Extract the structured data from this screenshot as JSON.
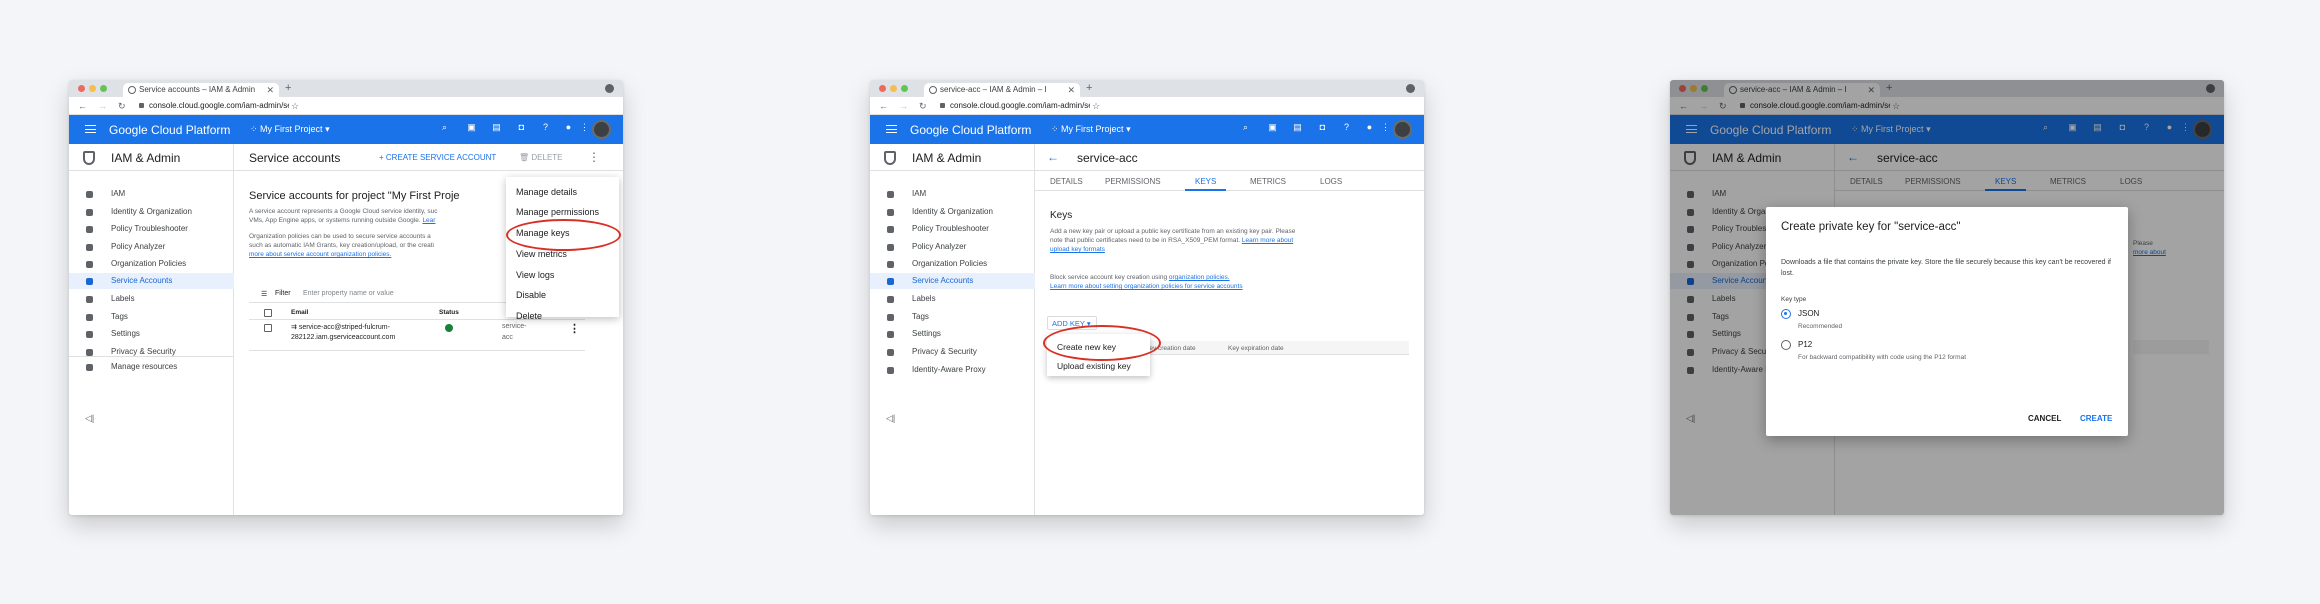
{
  "windows": [
    {
      "tab_title": "Service accounts – IAM & Admin",
      "url": "console.cloud.google.com/iam-admin/servic...",
      "brand": "Google Cloud Platform",
      "project": "My First Project",
      "side_title": "IAM & Admin",
      "nav": [
        "IAM",
        "Identity & Organization",
        "Policy Troubleshooter",
        "Policy Analyzer",
        "Organization Policies",
        "Service Accounts",
        "Labels",
        "Tags",
        "Settings",
        "Privacy & Security"
      ],
      "nav_active": "Service Accounts",
      "manage_resources": "Manage resources",
      "page_title": "Service accounts",
      "create_label": "+ CREATE SERVICE ACCOUNT",
      "delete_label": "DELETE",
      "subtitle": "Service accounts for project \"My First Proje",
      "para1": "A service account represents a Google Cloud service identity, suc",
      "para1b": "VMs, App Engine apps, or systems running outside Google.",
      "para1_link": "Lear",
      "para2": "Organization policies can be used to secure service accounts a",
      "para2b": "such as automatic IAM Grants, key creation/upload, or the creati",
      "para2_link": "more about service account organization policies.",
      "filter_label": "Filter",
      "filter_placeholder": "Enter property name or value",
      "col_email": "Email",
      "col_status": "Status",
      "row_email": "service-acc@striped-fulcrum-",
      "row_email2": "282122.iam.gserviceaccount.com",
      "row_name": "service-",
      "row_name2": "acc",
      "menu": [
        "Manage details",
        "Manage permissions",
        "Manage keys",
        "View metrics",
        "View logs",
        "Disable",
        "Delete"
      ],
      "side_suffix1": "gine",
      "side_suffix2": "earn",
      "col_suffix": "ons"
    },
    {
      "tab_title": "service-acc – IAM & Admin – I",
      "url": "console.cloud.google.com/iam-admin/servic...",
      "brand": "Google Cloud Platform",
      "project": "My First Project",
      "side_title": "IAM & Admin",
      "nav": [
        "IAM",
        "Identity & Organization",
        "Policy Troubleshooter",
        "Policy Analyzer",
        "Organization Policies",
        "Service Accounts",
        "Labels",
        "Tags",
        "Settings",
        "Privacy & Security",
        "Identity-Aware Proxy"
      ],
      "nav_active": "Service Accounts",
      "page_title": "service-acc",
      "tabs": [
        "DETAILS",
        "PERMISSIONS",
        "KEYS",
        "METRICS",
        "LOGS"
      ],
      "active_tab": "KEYS",
      "keys_heading": "Keys",
      "keys_text1": "Add a new key pair or upload a public key certificate from an existing key pair. Please",
      "keys_text2": "note that public certificates need to be in RSA_X509_PEM format.",
      "keys_link1": "Learn more about",
      "keys_link1b": "upload key formats",
      "block_text": "Block service account key creation using",
      "block_link": "organization policies.",
      "block_link2": "Learn more about setting organization policies for service accounts",
      "add_key": "ADD KEY",
      "col_creation": "Key creation date",
      "col_expiration": "Key expiration date",
      "dropdown": [
        "Create new key",
        "Upload existing key"
      ]
    },
    {
      "tab_title": "service-acc – IAM & Admin – I",
      "url": "console.cloud.google.com/iam-admin/servic...",
      "brand": "Google Cloud Platform",
      "project": "My First Project",
      "side_title": "IAM & Admin",
      "nav": [
        "IAM",
        "Identity & Organization",
        "Policy Troubleshooter",
        "Policy Analyzer",
        "Organization Policies",
        "Service Accounts",
        "Labels",
        "Tags",
        "Settings",
        "Privacy & Security",
        "Identity-Aware Proxy"
      ],
      "page_title": "service-acc",
      "tabs": [
        "DETAILS",
        "PERMISSIONS",
        "KEYS",
        "METRICS",
        "LOGS"
      ],
      "bg_text1": "Please",
      "bg_text2": "more about",
      "dialog": {
        "title": "Create private key for \"service-acc\"",
        "desc": "Downloads a file that contains the private key. Store the file securely because this key can't be recovered if lost.",
        "key_type": "Key type",
        "opt1": "JSON",
        "opt1_sub": "Recommended",
        "opt2": "P12",
        "opt2_sub": "For backward compatibility with code using the P12 format",
        "cancel": "CANCEL",
        "create": "CREATE"
      }
    }
  ],
  "colors": {
    "accent": "#1a73e8",
    "highlight": "#d93025"
  }
}
